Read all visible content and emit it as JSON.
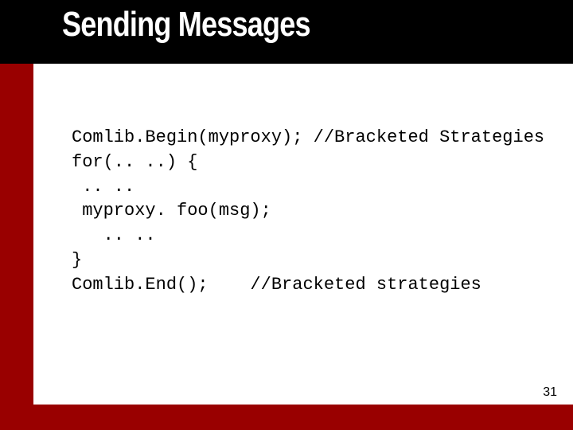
{
  "slide": {
    "title": "Sending Messages",
    "page_number": "31",
    "code_lines": {
      "l0": "Comlib.Begin(myproxy); //Bracketed Strategies",
      "l1": "for(.. ..) {",
      "l2": " .. ..",
      "l3": " myproxy. foo(msg);",
      "l4": "   .. ..",
      "l5": "}",
      "l6": "Comlib.End();    //Bracketed strategies"
    }
  }
}
